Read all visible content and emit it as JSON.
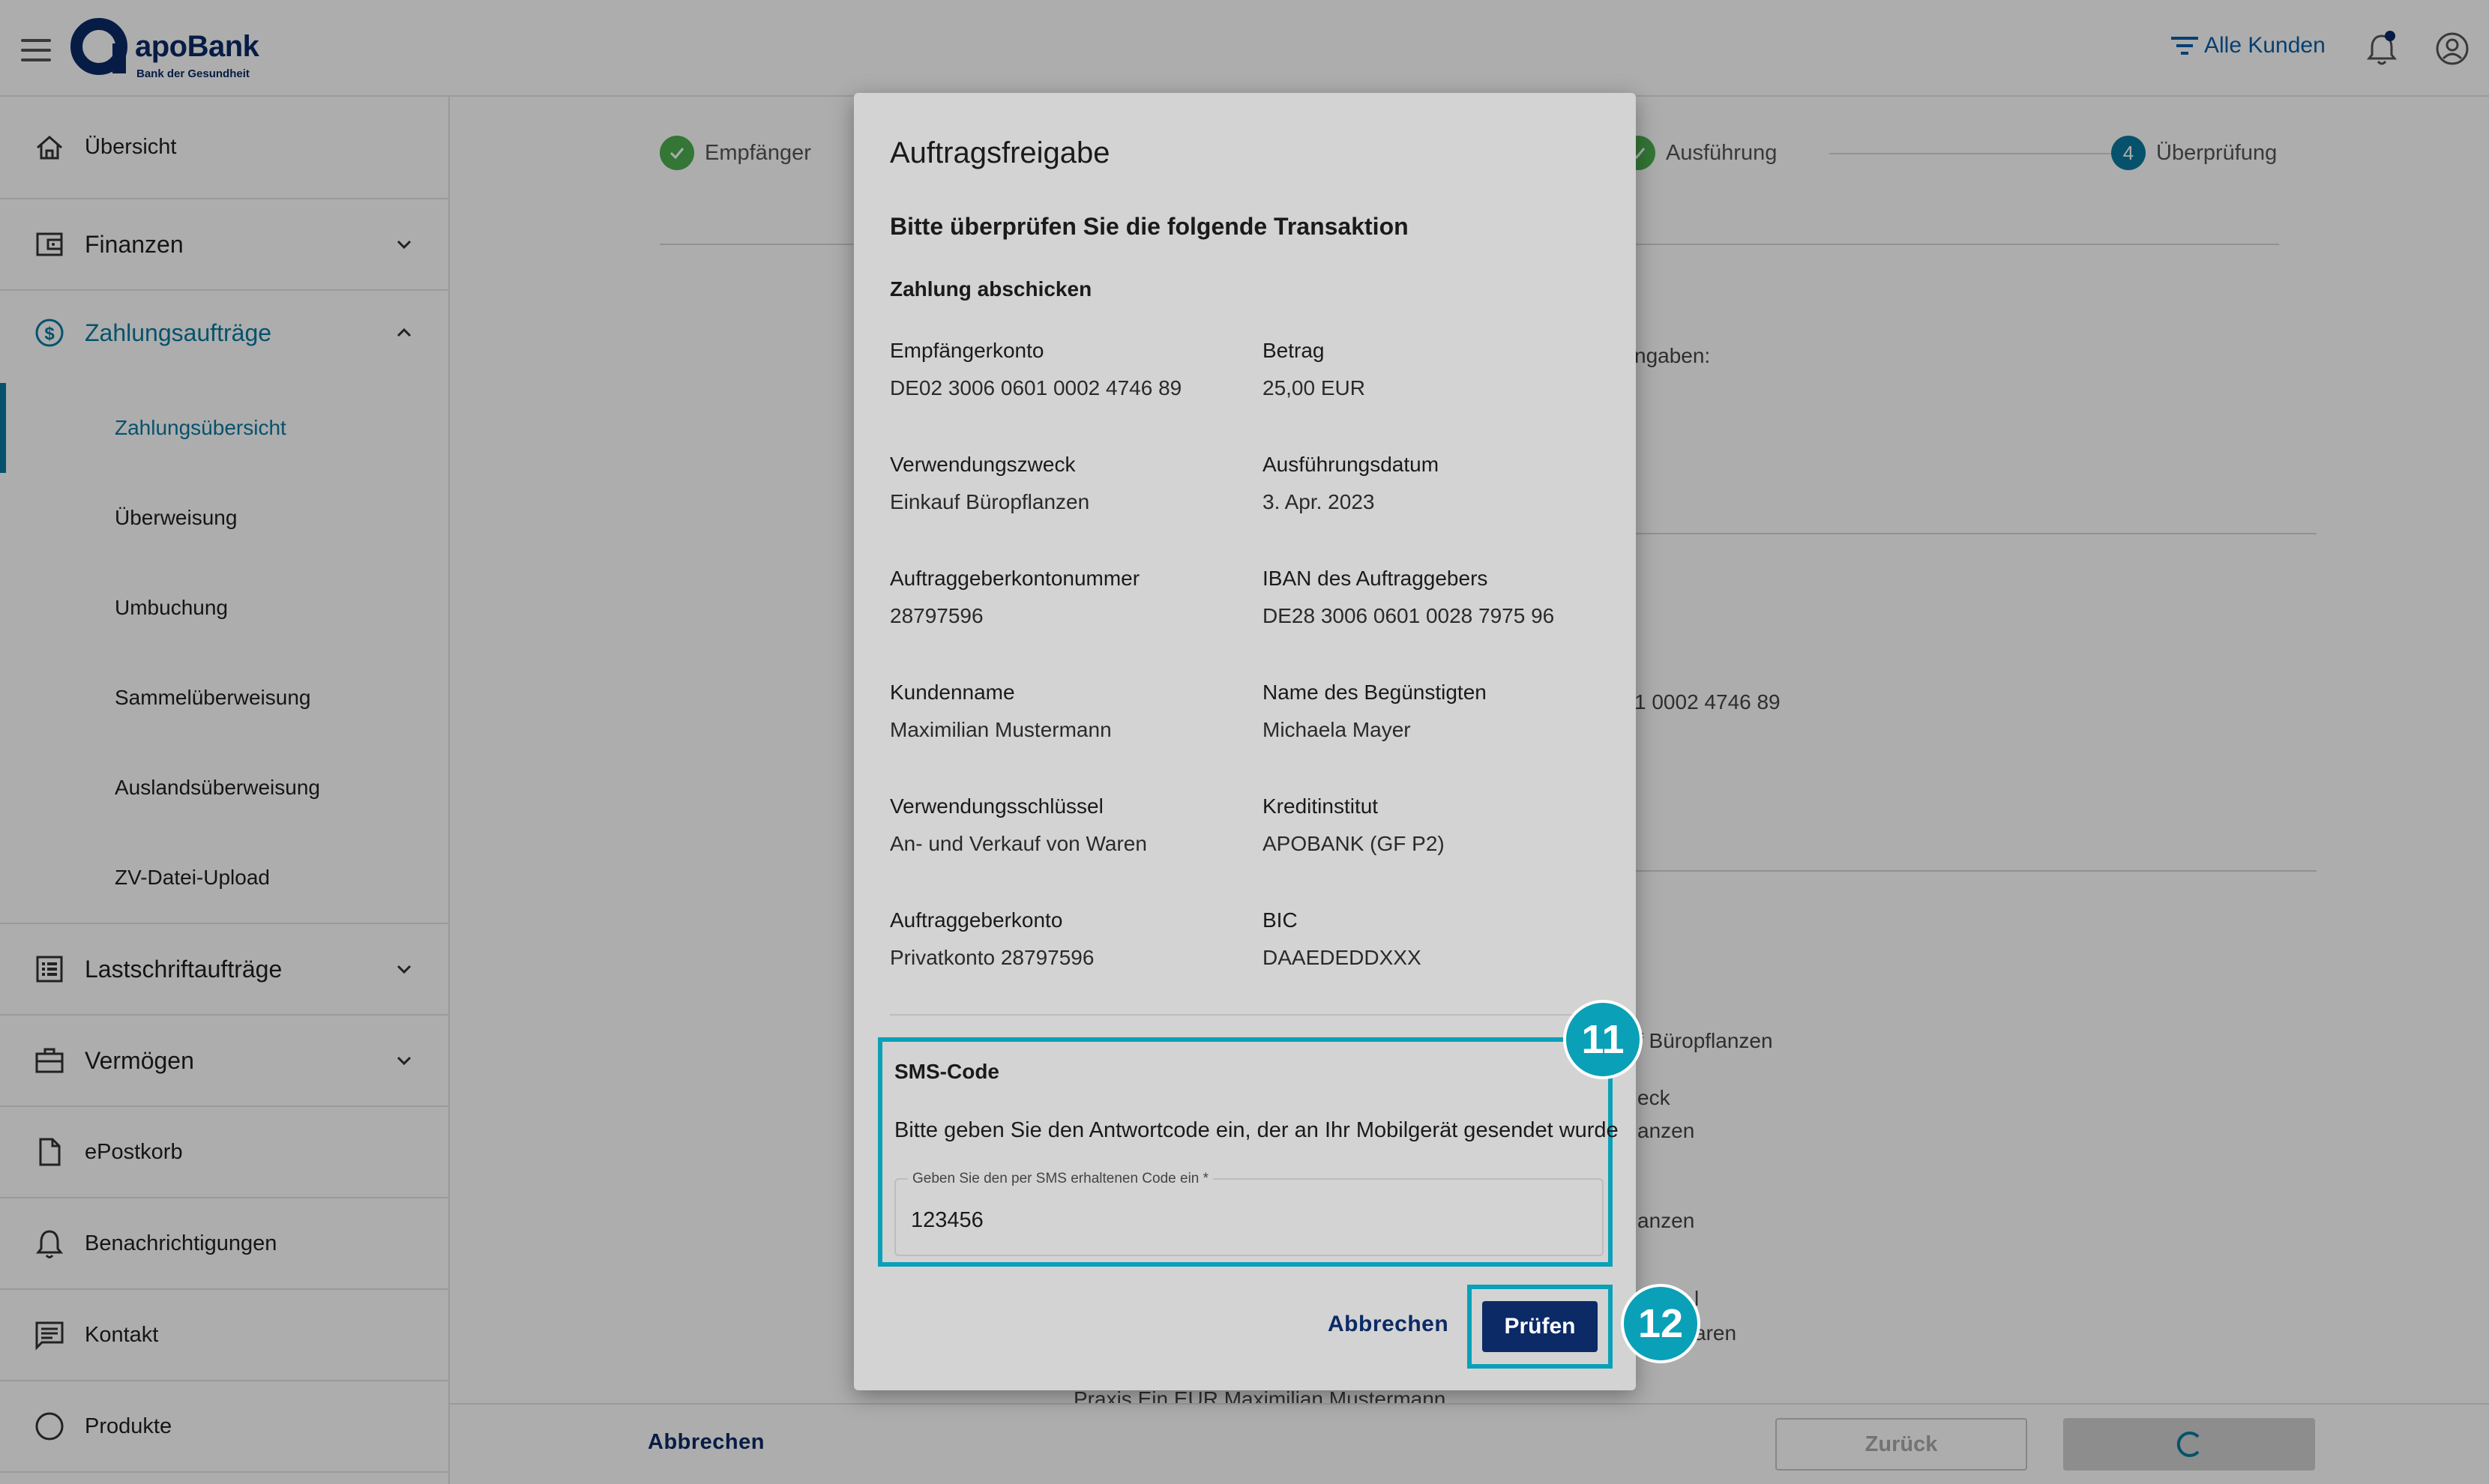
{
  "header": {
    "brand_name": "apoBank",
    "brand_tagline": "Bank der Gesundheit",
    "filter_label": "Alle Kunden"
  },
  "sidebar": {
    "items": [
      {
        "label": "Übersicht"
      },
      {
        "label": "Finanzen"
      },
      {
        "label": "Zahlungsaufträge"
      },
      {
        "label": "Lastschriftaufträge"
      },
      {
        "label": "Vermögen"
      },
      {
        "label": "ePostkorb"
      },
      {
        "label": "Benachrichtigungen"
      },
      {
        "label": "Kontakt"
      },
      {
        "label": "Produkte"
      }
    ],
    "sub_items": [
      {
        "label": "Zahlungsübersicht"
      },
      {
        "label": "Überweisung"
      },
      {
        "label": "Umbuchung"
      },
      {
        "label": "Sammelüberweisung"
      },
      {
        "label": "Auslandsüberweisung"
      },
      {
        "label": "ZV-Datei-Upload"
      }
    ]
  },
  "steps": [
    {
      "label": "Empfänger"
    },
    {
      "label": "Ausführung"
    },
    {
      "number": "4",
      "label": "Überprüfung"
    }
  ],
  "background": {
    "t1": "ngaben:",
    "t2": "1 0002 4746 89",
    "t3": "f Büropflanzen",
    "t4": "eck",
    "t5": "anzen",
    "t6": "anzen",
    "t7": "l",
    "t8": "aren",
    "t9": "Praxis Ein EUR Maximilian Mustermann"
  },
  "footer": {
    "cancel_label": "Abbrechen",
    "back_label": "Zurück"
  },
  "dialog": {
    "title": "Auftragsfreigabe",
    "subtitle": "Bitte überprüfen Sie die folgende Transaktion",
    "section": "Zahlung abschicken",
    "fields": [
      {
        "label": "Empfängerkonto",
        "value": "DE02 3006 0601 0002 4746 89"
      },
      {
        "label": "Betrag",
        "value": "25,00 EUR"
      },
      {
        "label": "Verwendungszweck",
        "value": "Einkauf Büropflanzen"
      },
      {
        "label": "Ausführungsdatum",
        "value": "3. Apr. 2023"
      },
      {
        "label": "Auftraggeberkontonummer",
        "value": "28797596"
      },
      {
        "label": "IBAN des Auftraggebers",
        "value": "DE28 3006 0601 0028 7975 96"
      },
      {
        "label": "Kundenname",
        "value": "Maximilian Mustermann"
      },
      {
        "label": "Name des Begünstigten",
        "value": "Michaela Mayer"
      },
      {
        "label": "Verwendungsschlüssel",
        "value": "An- und Verkauf von Waren"
      },
      {
        "label": "Kreditinstitut",
        "value": "APOBANK (GF P2)"
      },
      {
        "label": "Auftraggeberkonto",
        "value": "Privatkonto 28797596"
      },
      {
        "label": "BIC",
        "value": "DAAEDEDDXXX"
      }
    ],
    "sms": {
      "title": "SMS-Code",
      "hint": "Bitte geben Sie den Antwortcode ein, der an Ihr Mobilgerät gesendet wurde",
      "field_label": "Geben Sie den per SMS erhaltenen Code ein *",
      "value": "123456"
    },
    "cancel_label": "Abbrechen",
    "check_label": "Prüfen"
  },
  "annotations": {
    "badge_11": "11",
    "badge_12": "12"
  },
  "colors": {
    "brand_navy": "#0b2a66",
    "accent_teal": "#0a7aa0",
    "highlight": "#0aa0b8",
    "success_green": "#4caf50"
  }
}
